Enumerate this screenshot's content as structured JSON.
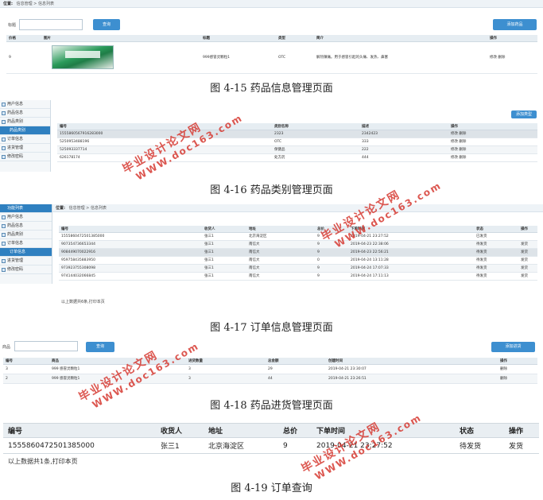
{
  "fig15": {
    "breadcrumb": {
      "prefix": "位置:",
      "path": "信息管理 > 信息列表"
    },
    "search_label": "标题",
    "search_btn": "查询",
    "add_btn": "添加药品",
    "headers": [
      "价格",
      "图片",
      "标题",
      "类型",
      "简介",
      "操作"
    ],
    "row": {
      "price": "9",
      "title": "999感冒灵颗粒1",
      "type": "OTC",
      "intro": "解热镇痛。用于感冒引起的头痛、发热、鼻塞",
      "ops": "修改 删除"
    },
    "caption": "图 4-15  药品信息管理页面"
  },
  "fig16": {
    "sidebar": [
      "用户信息",
      "药品信息",
      "药品类别",
      "药品类别",
      "订单信息",
      "进货管理",
      "修改密码"
    ],
    "add_btn": "添加类型",
    "headers": [
      "编号",
      "类别名称",
      "描述",
      "操作"
    ],
    "rows": [
      {
        "id": "1555860567916283000",
        "name": "2323",
        "desc": "2342423",
        "ops": "修改 删除"
      },
      {
        "id": "5250953488196",
        "name": "OTC",
        "desc": "333",
        "ops": "修改 删除"
      },
      {
        "id": "525093337714",
        "name": "保健品",
        "desc": "222",
        "ops": "修改 删除"
      },
      {
        "id": "626178174",
        "name": "处方药",
        "desc": "444",
        "ops": "修改 删除"
      }
    ],
    "caption": "图 4-16  药品类别管理页面"
  },
  "fig17": {
    "sidebar_head": "功能列表",
    "sidebar": [
      "用户信息",
      "药品信息",
      "药品类别",
      "订单信息",
      "订单信息",
      "进货管理",
      "修改密码"
    ],
    "breadcrumb": {
      "prefix": "位置:",
      "path": "信息管理 > 信息列表"
    },
    "headers": [
      "编号",
      "收货人",
      "地址",
      "总价",
      "下单时间",
      "状态",
      "操作"
    ],
    "rows": [
      {
        "id": "1555860472501385000",
        "name": "张三1",
        "addr": "北京海淀区",
        "total": "9",
        "time": "2019-04-21 23:27:52",
        "status": "已发货",
        "op": ""
      },
      {
        "id": "907354736653344",
        "name": "张三1",
        "addr": "南信大",
        "total": "9",
        "time": "2019-04-23 22:38:06",
        "status": "待发货",
        "op": "发货"
      },
      {
        "id": "908449070022916",
        "name": "张三1",
        "addr": "南信大",
        "total": "9",
        "time": "2019-04-23 22:56:21",
        "status": "待发货",
        "op": "发货"
      },
      {
        "id": "959758435883950",
        "name": "张三1",
        "addr": "南信大",
        "total": "0",
        "time": "2019-04-24 13:11:28",
        "status": "待发货",
        "op": "发货"
      },
      {
        "id": "973923755308098",
        "name": "张三1",
        "addr": "南信大",
        "total": "9",
        "time": "2019-04-24 17:07:33",
        "status": "待发货",
        "op": "发货"
      },
      {
        "id": "974144032066845",
        "name": "张三1",
        "addr": "南信大",
        "total": "9",
        "time": "2019-04-24 17:11:13",
        "status": "待发货",
        "op": "发货"
      }
    ],
    "footer": "以上数据共6条,打印本页",
    "caption": "图 4-17  订单信息管理页面"
  },
  "fig18": {
    "search_label": "商品",
    "search_btn": "查询",
    "add_btn": "添加进货",
    "headers": [
      "编号",
      "商品",
      "进货数量",
      "总金额",
      "创建时间",
      "操作"
    ],
    "rows": [
      {
        "id": "3",
        "goods": "999 感冒灵颗粒1",
        "qty": "3",
        "total": "29",
        "time": "2019-04-21 23:30:07",
        "op": "删除"
      },
      {
        "id": "2",
        "goods": "999 感冒灵颗粒1",
        "qty": "3",
        "total": "44",
        "time": "2019-04-21 23:26:51",
        "op": "删除"
      }
    ],
    "caption": "图 4-18  药品进货管理页面"
  },
  "fig19": {
    "headers": [
      "编号",
      "收货人",
      "地址",
      "总价",
      "下单时间",
      "状态",
      "操作"
    ],
    "row": {
      "id": "1555860472501385000",
      "name": "张三1",
      "addr": "北京海淀区",
      "total": "9",
      "time": "2019-04-21 23:27:52",
      "status": "待发货",
      "op": "发货"
    },
    "footer": "以上数据共1条,打印本页",
    "caption": "图 4-19 订单查询"
  },
  "watermark": {
    "line1": "毕业设计论文网",
    "line2": "WWW.doc163.com"
  },
  "colors": {
    "accent": "#3d8fd0",
    "watermark": "#d63a32"
  }
}
